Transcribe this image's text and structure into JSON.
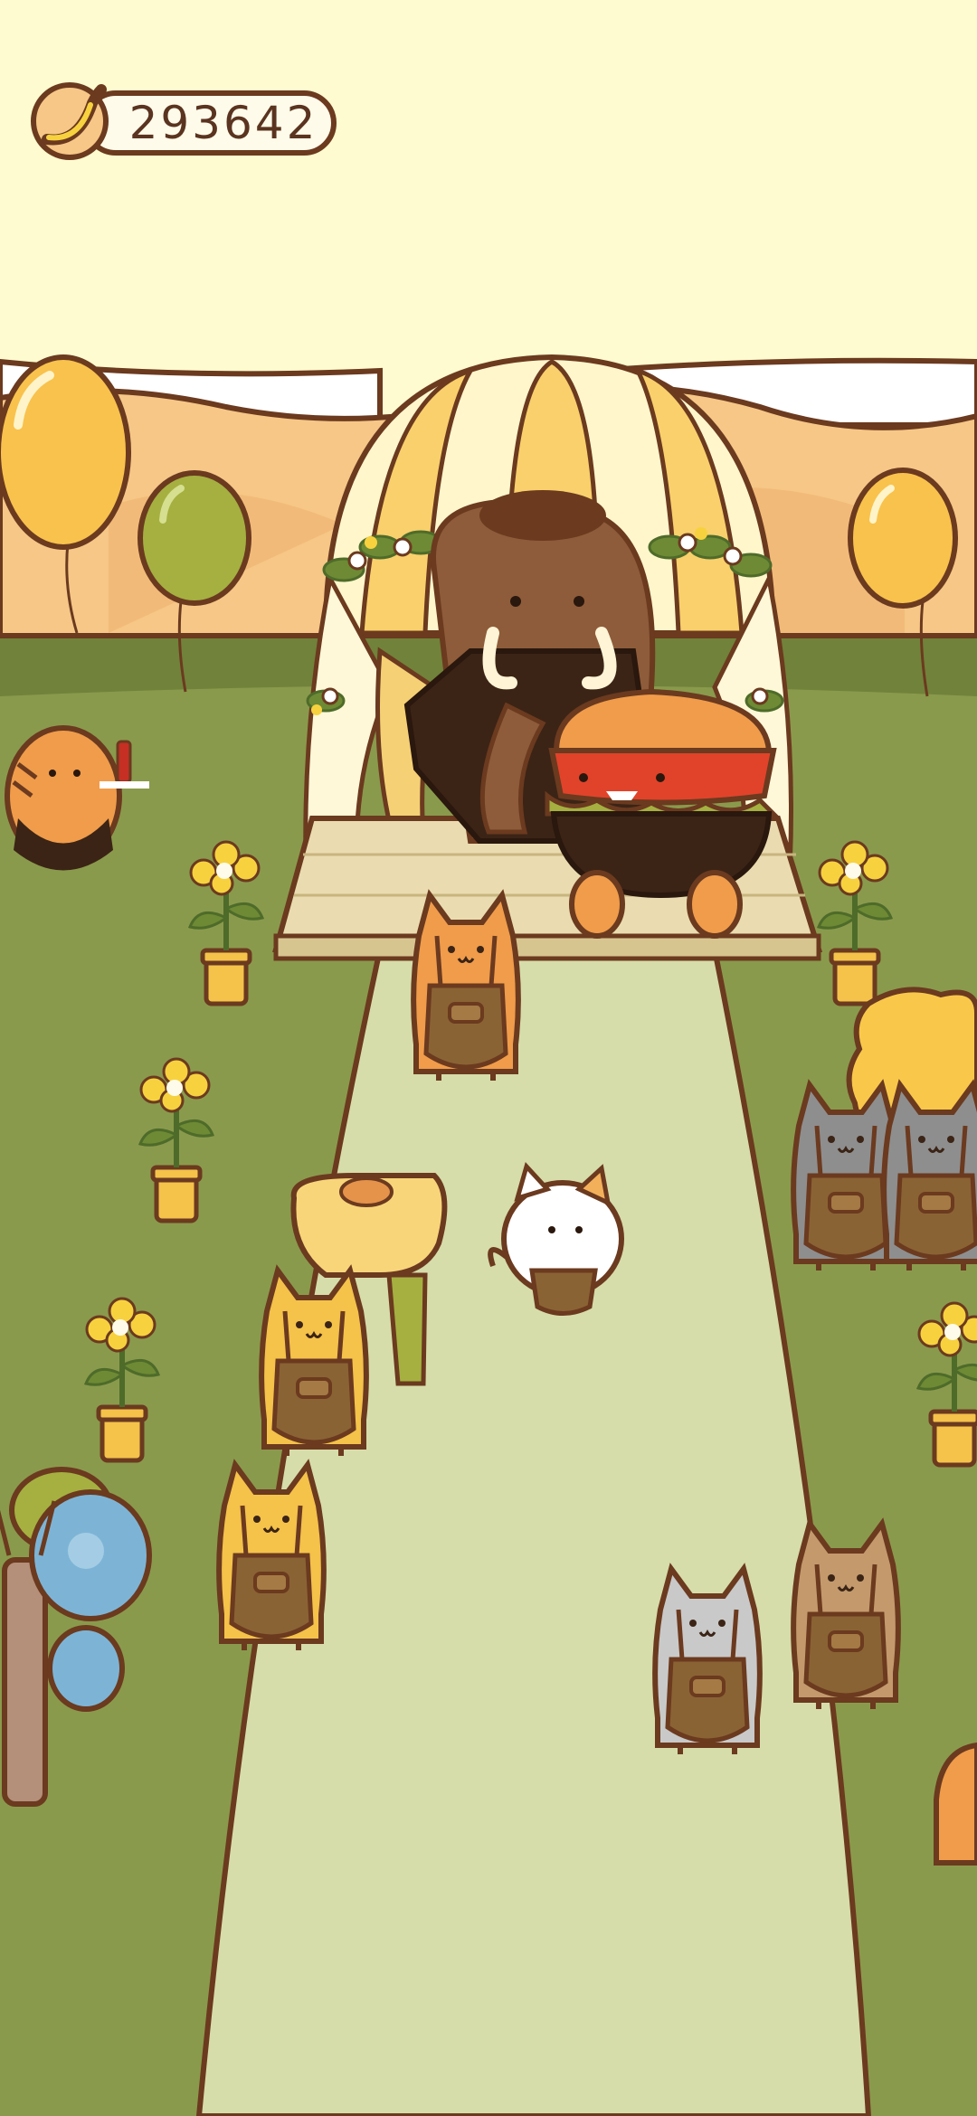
{
  "hud": {
    "currency_icon": "banana-icon",
    "currency_value": "293642"
  },
  "scene": {
    "setting": "garden-wedding",
    "colors": {
      "sky": "#fdfbcf",
      "hills": "#f6c786",
      "grass": "#8a9a4c",
      "aisle": "#d6ddaa",
      "outline": "#6b3a1f"
    }
  }
}
